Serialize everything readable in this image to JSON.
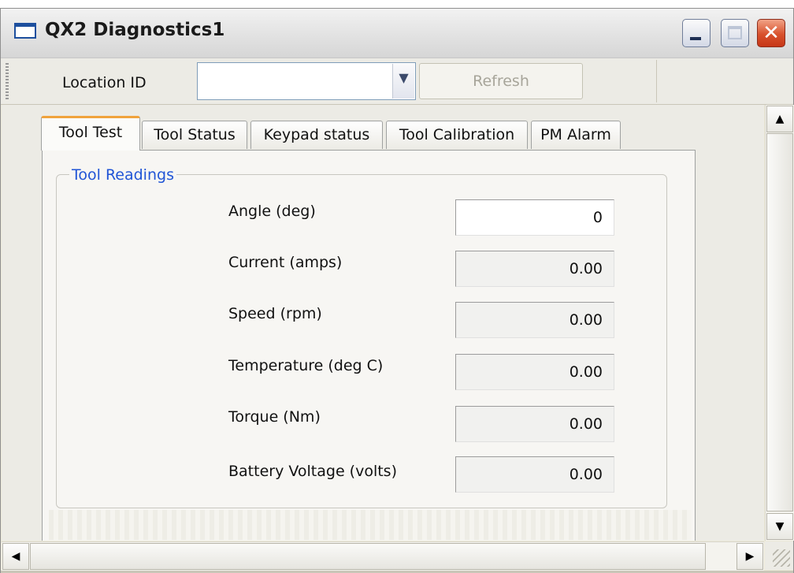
{
  "window": {
    "title": "QX2 Diagnostics1"
  },
  "title_buttons": {
    "minimize_icon": "minimize-icon",
    "maximize_icon": "maximize-icon",
    "close_icon": "close-icon",
    "close_glyph": "✕"
  },
  "toolbar": {
    "location_label": "Location ID",
    "location_value": "",
    "dropdown_glyph": "▼",
    "refresh_label": "Refresh"
  },
  "tabs": [
    {
      "label": "Tool Test",
      "active": true
    },
    {
      "label": "Tool Status",
      "active": false
    },
    {
      "label": "Keypad status",
      "active": false
    },
    {
      "label": "Tool Calibration",
      "active": false
    },
    {
      "label": "PM Alarm",
      "active": false
    }
  ],
  "group": {
    "title": "Tool Readings",
    "rows": [
      {
        "label": "Angle (deg)",
        "value": "0"
      },
      {
        "label": "Current (amps)",
        "value": "0.00"
      },
      {
        "label": "Speed (rpm)",
        "value": "0.00"
      },
      {
        "label": "Temperature (deg C)",
        "value": "0.00"
      },
      {
        "label": "Torque (Nm)",
        "value": "0.00"
      },
      {
        "label": "Battery Voltage (volts)",
        "value": "0.00"
      }
    ]
  },
  "scrollbars": {
    "up": "▲",
    "down": "▼",
    "left": "◀",
    "right": "▶"
  },
  "colors": {
    "accent_tab": "#f0a33c",
    "group_title": "#2155d6",
    "close_button": "#d8512c"
  }
}
